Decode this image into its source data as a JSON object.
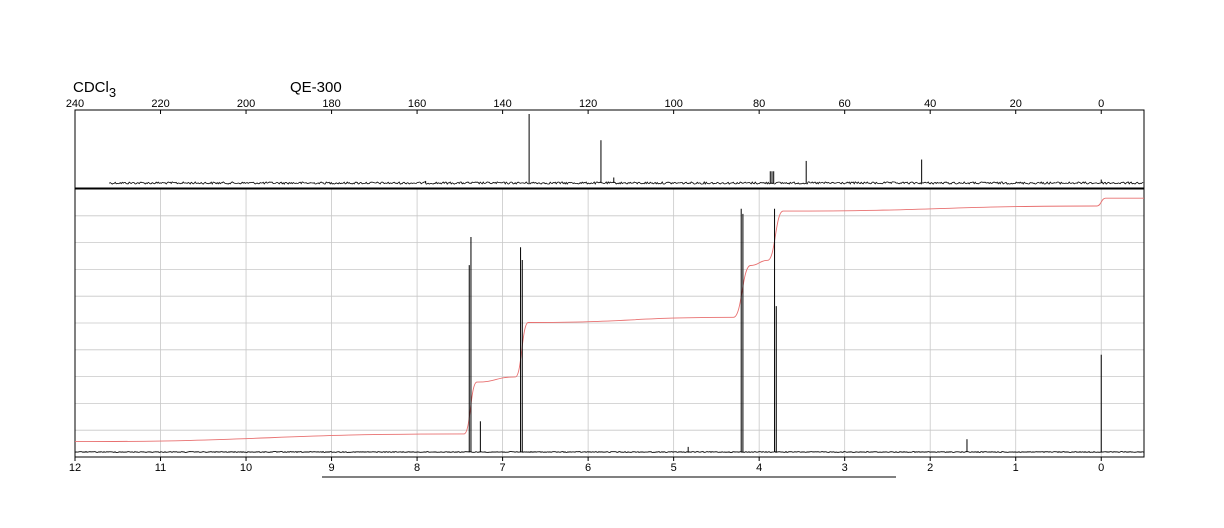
{
  "header": {
    "solvent": "CDCl",
    "solvent_sub": "3",
    "instrument": "QE-300"
  },
  "chart_data": [
    {
      "type": "line",
      "spectrum": "13C NMR",
      "x_reversed": true,
      "xlim": [
        240,
        -10
      ],
      "x_ticks": [
        240,
        220,
        200,
        180,
        160,
        140,
        120,
        100,
        80,
        60,
        40,
        20,
        0
      ],
      "x_tick_labels": [
        "240",
        "220",
        "200",
        "180",
        "160",
        "140",
        "120",
        "100",
        "80",
        "60",
        "40",
        "20",
        "0"
      ],
      "grid": false,
      "peaks": [
        {
          "ppm": 158.0,
          "intensity": 0.03
        },
        {
          "ppm": 133.8,
          "intensity": 1.0
        },
        {
          "ppm": 117.0,
          "intensity": 0.62
        },
        {
          "ppm": 114.0,
          "intensity": 0.08
        },
        {
          "ppm": 77.4,
          "intensity": 0.17
        },
        {
          "ppm": 77.0,
          "intensity": 0.17
        },
        {
          "ppm": 76.6,
          "intensity": 0.17
        },
        {
          "ppm": 69.0,
          "intensity": 0.32
        },
        {
          "ppm": 42.0,
          "intensity": 0.34
        },
        {
          "ppm": 0.0,
          "intensity": 0.05
        }
      ]
    },
    {
      "type": "line",
      "spectrum": "1H NMR",
      "x_reversed": true,
      "xlim": [
        12,
        -0.5
      ],
      "x_ticks": [
        12,
        11,
        10,
        9,
        8,
        7,
        6,
        5,
        4,
        3,
        2,
        1,
        0
      ],
      "x_tick_labels": [
        "12",
        "11",
        "10",
        "9",
        "8",
        "7",
        "6",
        "5",
        "4",
        "3",
        "2",
        "1",
        "0"
      ],
      "grid": true,
      "peaks": [
        {
          "ppm": 7.39,
          "intensity": 0.73
        },
        {
          "ppm": 7.37,
          "intensity": 0.84
        },
        {
          "ppm": 7.26,
          "intensity": 0.12
        },
        {
          "ppm": 6.79,
          "intensity": 0.8
        },
        {
          "ppm": 6.77,
          "intensity": 0.75
        },
        {
          "ppm": 4.83,
          "intensity": 0.02
        },
        {
          "ppm": 4.21,
          "intensity": 0.95
        },
        {
          "ppm": 4.19,
          "intensity": 0.93
        },
        {
          "ppm": 3.82,
          "intensity": 0.95
        },
        {
          "ppm": 3.8,
          "intensity": 0.57
        },
        {
          "ppm": 1.57,
          "intensity": 0.05
        },
        {
          "ppm": 0.0,
          "intensity": 0.38
        }
      ],
      "integral": [
        {
          "ppm": 12.0,
          "level": 0.04
        },
        {
          "ppm": 7.45,
          "level": 0.07
        },
        {
          "ppm": 7.3,
          "level": 0.27
        },
        {
          "ppm": 6.85,
          "level": 0.29
        },
        {
          "ppm": 6.7,
          "level": 0.5
        },
        {
          "ppm": 4.3,
          "level": 0.52
        },
        {
          "ppm": 4.1,
          "level": 0.72
        },
        {
          "ppm": 3.9,
          "level": 0.74
        },
        {
          "ppm": 3.72,
          "level": 0.93
        },
        {
          "ppm": 0.05,
          "level": 0.95
        },
        {
          "ppm": -0.05,
          "level": 0.98
        },
        {
          "ppm": -0.5,
          "level": 0.98
        }
      ],
      "integral_color": "#e87070"
    }
  ]
}
